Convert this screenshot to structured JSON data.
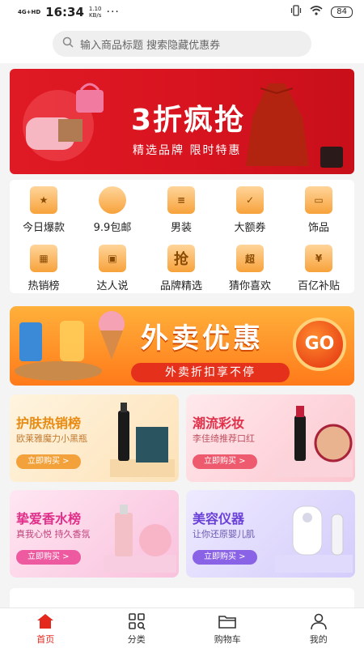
{
  "status": {
    "network": "4G+HD",
    "time": "16:34",
    "speed_value": "1.10",
    "speed_unit": "KB/s",
    "battery": "84"
  },
  "search": {
    "placeholder": "输入商品标题 搜索隐藏优惠券"
  },
  "banner": {
    "title": "3折疯抢",
    "subtitle": "精选品牌 限时特惠"
  },
  "categories": [
    {
      "label": "今日爆款",
      "icon": "hot-icon"
    },
    {
      "label": "9.9包邮",
      "icon": "bowl-icon"
    },
    {
      "label": "男装",
      "icon": "clothes-icon"
    },
    {
      "label": "大额券",
      "icon": "coupon-icon"
    },
    {
      "label": "饰品",
      "icon": "accessory-icon"
    },
    {
      "label": "热销榜",
      "icon": "grid-icon"
    },
    {
      "label": "达人说",
      "icon": "box-icon"
    },
    {
      "label": "品牌精选",
      "icon": "grab-icon",
      "glyph": "抢"
    },
    {
      "label": "猜你喜欢",
      "icon": "house-icon",
      "glyph": "超"
    },
    {
      "label": "百亿补贴",
      "icon": "yuan-icon",
      "glyph": "¥"
    }
  ],
  "waimai": {
    "title": "外卖优惠",
    "pill": "外卖折扣享不停",
    "go": "GO"
  },
  "promos": [
    {
      "title": "护肤热销榜",
      "subtitle": "欧莱雅魔力小黑瓶",
      "button": "立即购买 >",
      "title_color": "#e88a10",
      "btn_color": "#f3a13a"
    },
    {
      "title": "潮流彩妆",
      "subtitle": "李佳绮推荐口红",
      "button": "立即购买 >",
      "title_color": "#e0304a",
      "btn_color": "#ee5a6e"
    },
    {
      "title": "挚爱香水榜",
      "subtitle": "真我心悦 持久香氛",
      "button": "立即购买 >",
      "title_color": "#e0308a",
      "btn_color": "#ee5aa0"
    },
    {
      "title": "美容仪器",
      "subtitle": "让你还原婴儿肌",
      "button": "立即购买 >",
      "title_color": "#6a40d8",
      "btn_color": "#8a62e6"
    }
  ],
  "tabbar": [
    {
      "label": "首页",
      "icon": "home-icon",
      "active": true
    },
    {
      "label": "分类",
      "icon": "category-icon",
      "active": false
    },
    {
      "label": "购物车",
      "icon": "folder-icon",
      "active": false
    },
    {
      "label": "我的",
      "icon": "user-icon",
      "active": false
    }
  ],
  "colors": {
    "accent": "#e4281e",
    "banner": "#e01a24",
    "waimai": "#ff8a1f"
  }
}
